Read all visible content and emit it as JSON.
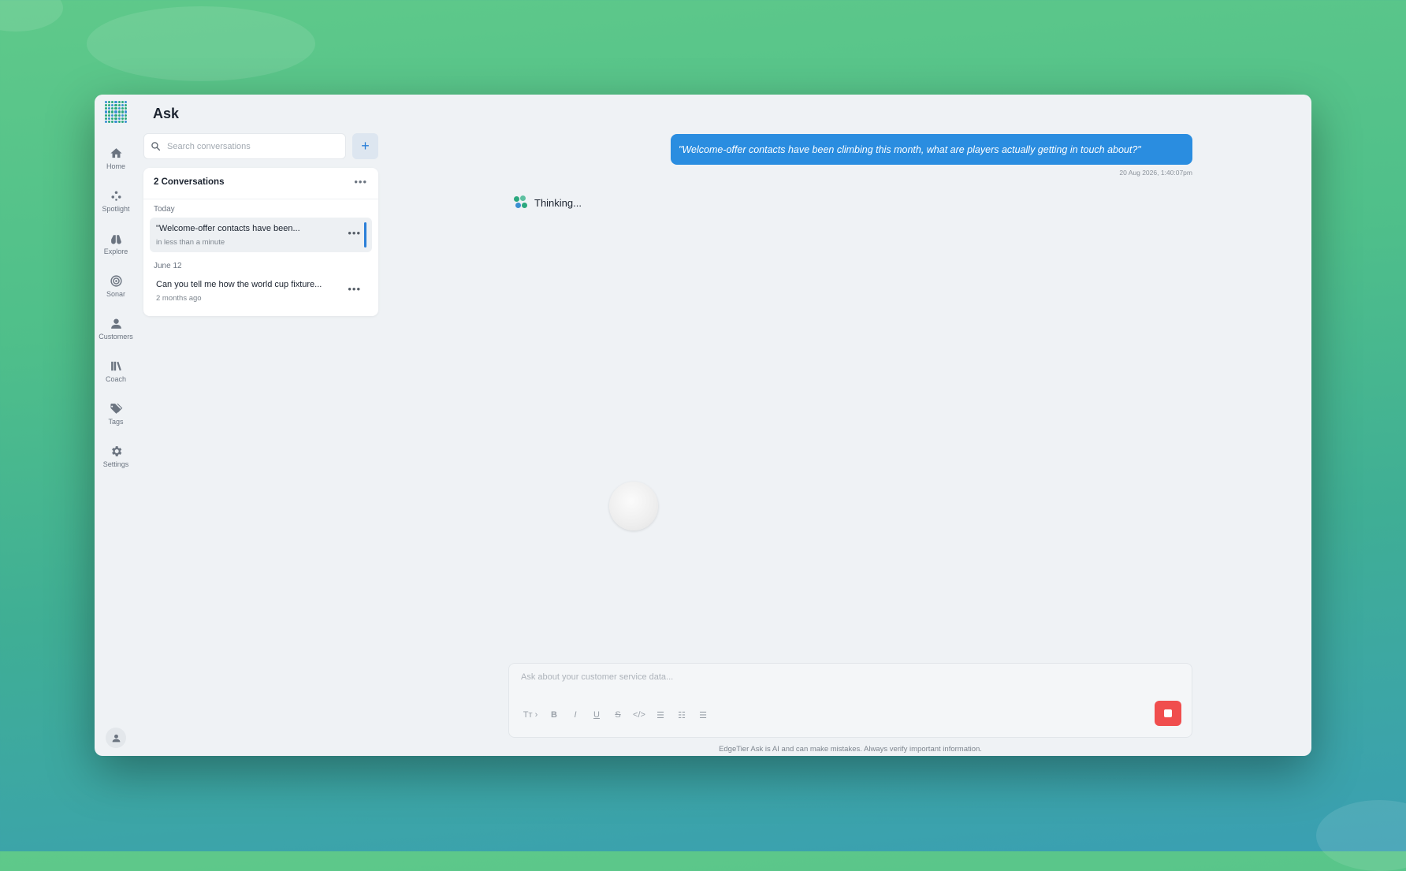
{
  "app": {
    "page_title": "Ask",
    "colors": {
      "accent": "#2a8de0",
      "stop": "#f04e4e",
      "brand": "#2aa87e"
    }
  },
  "nav": {
    "items": [
      {
        "id": "home",
        "label": "Home",
        "icon": "home-icon"
      },
      {
        "id": "spotlight",
        "label": "Spotlight",
        "icon": "spotlight-icon"
      },
      {
        "id": "explore",
        "label": "Explore",
        "icon": "binoculars-icon"
      },
      {
        "id": "sonar",
        "label": "Sonar",
        "icon": "target-icon"
      },
      {
        "id": "customers",
        "label": "Customers",
        "icon": "person-icon"
      },
      {
        "id": "coach",
        "label": "Coach",
        "icon": "books-icon"
      },
      {
        "id": "tags",
        "label": "Tags",
        "icon": "tag-icon"
      },
      {
        "id": "settings",
        "label": "Settings",
        "icon": "gear-icon"
      }
    ],
    "bottom_icon": "user-avatar-icon"
  },
  "sidebar": {
    "search_placeholder": "Search conversations",
    "add_icon": "plus-icon",
    "count_label": "2 Conversations",
    "groups": [
      {
        "label": "Today",
        "items": [
          {
            "title": "\"Welcome-offer contacts have been...",
            "subtitle": "in less than a minute",
            "active": true
          }
        ]
      },
      {
        "label": "June 12",
        "items": [
          {
            "title": "Can you tell me how the world cup fixture...",
            "subtitle": "2 months ago",
            "active": false
          }
        ]
      }
    ]
  },
  "chat": {
    "user_message": "\"Welcome-offer contacts have been climbing this month, what are players actually getting in touch about?\"",
    "timestamp": "20 Aug 2026, 1:40:07pm",
    "status": "Thinking..."
  },
  "composer": {
    "placeholder": "Ask about your customer service data...",
    "toolbar": [
      {
        "name": "text-style-icon",
        "glyph": "Tт ›"
      },
      {
        "name": "bold-icon",
        "glyph": "B"
      },
      {
        "name": "italic-icon",
        "glyph": "I"
      },
      {
        "name": "underline-icon",
        "glyph": "U"
      },
      {
        "name": "strikethrough-icon",
        "glyph": "S"
      },
      {
        "name": "code-icon",
        "glyph": "</>"
      },
      {
        "name": "bullet-list-icon",
        "glyph": "☰"
      },
      {
        "name": "numbered-list-icon",
        "glyph": "☷"
      },
      {
        "name": "indent-list-icon",
        "glyph": "☰"
      }
    ],
    "stop_icon": "stop-icon",
    "disclaimer": "EdgeTier Ask is AI and can make mistakes. Always verify important information."
  }
}
